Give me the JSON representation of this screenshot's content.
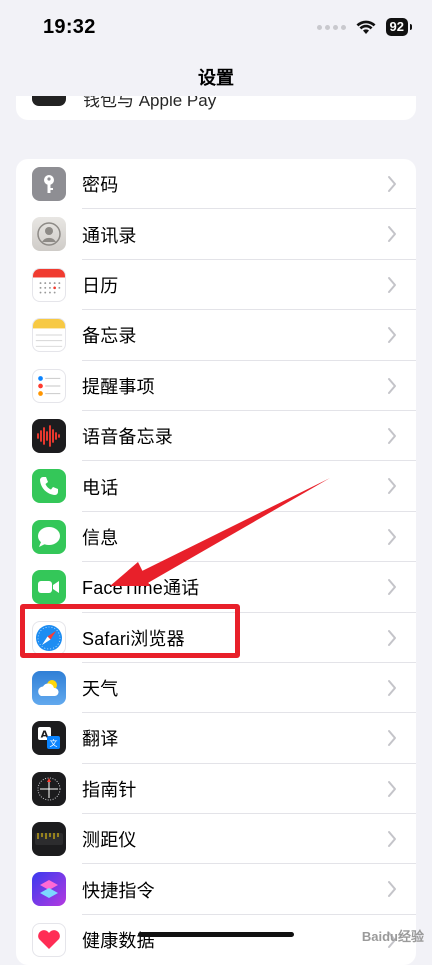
{
  "status_bar": {
    "time": "19:32",
    "battery": "92"
  },
  "nav": {
    "title": "设置"
  },
  "previous_item": {
    "label": "钱包与 Apple Pay"
  },
  "settings": [
    {
      "label": "密码",
      "icon": "key-icon"
    },
    {
      "label": "通讯录",
      "icon": "contacts-icon"
    },
    {
      "label": "日历",
      "icon": "calendar-icon"
    },
    {
      "label": "备忘录",
      "icon": "notes-icon"
    },
    {
      "label": "提醒事项",
      "icon": "reminders-icon"
    },
    {
      "label": "语音备忘录",
      "icon": "voice-memos-icon"
    },
    {
      "label": "电话",
      "icon": "phone-icon"
    },
    {
      "label": "信息",
      "icon": "messages-icon"
    },
    {
      "label": "FaceTime通话",
      "icon": "facetime-icon"
    },
    {
      "label": "Safari浏览器",
      "icon": "safari-icon"
    },
    {
      "label": "天气",
      "icon": "weather-icon"
    },
    {
      "label": "翻译",
      "icon": "translate-icon"
    },
    {
      "label": "指南针",
      "icon": "compass-icon"
    },
    {
      "label": "测距仪",
      "icon": "measure-icon"
    },
    {
      "label": "快捷指令",
      "icon": "shortcuts-icon"
    },
    {
      "label": "健康数据",
      "icon": "health-icon"
    }
  ],
  "annotation": {
    "color": "#e8202a"
  },
  "watermark": "Baidu经验"
}
